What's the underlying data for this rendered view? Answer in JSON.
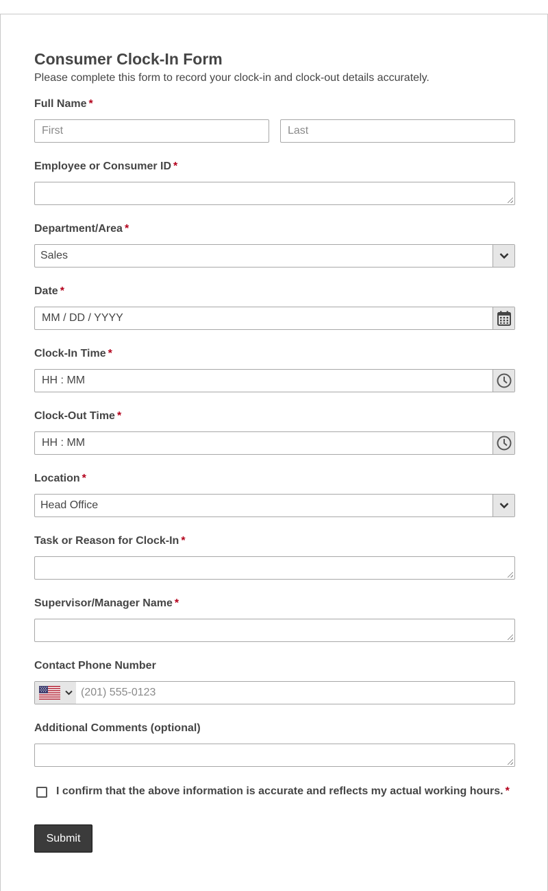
{
  "form": {
    "title": "Consumer Clock-In Form",
    "subtitle": "Please complete this form to record your clock-in and clock-out details accurately.",
    "required_marker": "*"
  },
  "full_name": {
    "label": "Full Name",
    "first_placeholder": "First",
    "last_placeholder": "Last"
  },
  "employee_id": {
    "label": "Employee or Consumer ID",
    "value": ""
  },
  "department": {
    "label": "Department/Area",
    "selected": "Sales"
  },
  "date": {
    "label": "Date",
    "placeholder": "MM / DD / YYYY",
    "icon": "calendar-icon"
  },
  "clock_in": {
    "label": "Clock-In Time",
    "placeholder": "HH : MM",
    "icon": "clock-icon"
  },
  "clock_out": {
    "label": "Clock-Out Time",
    "placeholder": "HH : MM",
    "icon": "clock-icon"
  },
  "location": {
    "label": "Location",
    "selected": "Head Office"
  },
  "task": {
    "label": "Task or Reason for Clock-In",
    "value": ""
  },
  "supervisor": {
    "label": "Supervisor/Manager Name",
    "value": ""
  },
  "phone": {
    "label": "Contact Phone Number",
    "placeholder": "(201) 555-0123",
    "country_icon": "us-flag-icon"
  },
  "comments": {
    "label": "Additional Comments (optional)",
    "value": ""
  },
  "confirm": {
    "label": "I confirm that the above information is accurate and reflects my actual working hours.",
    "checked": false
  },
  "submit": {
    "label": "Submit"
  },
  "colors": {
    "required": "#b3001b",
    "button_bg": "#3b3b3b",
    "addon_bg": "#e6e6e6",
    "border": "#a7a7a7"
  }
}
